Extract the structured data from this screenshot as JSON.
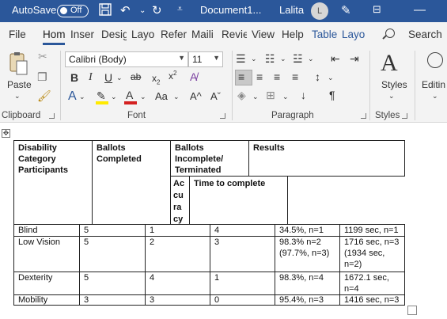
{
  "titlebar": {
    "autosave_label": "AutoSave",
    "autosave_state": "Off",
    "doc_name": "Document1...",
    "user_name": "Lalita",
    "user_initial": "L"
  },
  "tabs": [
    "File",
    "Hom",
    "Inser",
    "Desig",
    "Layo",
    "Refer",
    "Maili",
    "Revie",
    "View",
    "Help",
    "Table",
    "Layo"
  ],
  "search_label": "Search",
  "clipboard": {
    "paste": "Paste",
    "label": "Clipboard"
  },
  "font": {
    "name": "Calibri (Body)",
    "size": "11",
    "label": "Font"
  },
  "paragraph": {
    "label": "Paragraph"
  },
  "styles": {
    "label": "Styles",
    "button": "Styles"
  },
  "editing": {
    "button": "Editin"
  },
  "table": {
    "header": {
      "c1": [
        "Disability",
        "Category",
        "Participants"
      ],
      "c2": [
        "Ballots",
        "Completed"
      ],
      "c3": [
        "Ballots",
        "Incomplete/",
        "Terminated"
      ],
      "c4": "Results",
      "accuracy": [
        "Ac",
        "cu",
        "ra",
        "cy"
      ],
      "time": "Time to complete"
    },
    "rows": [
      {
        "category": "Blind",
        "completed": "5",
        "incomplete": "1",
        "terminated": "4",
        "accuracy": [
          "34.5%, n=1"
        ],
        "time": [
          "1199 sec, n=1"
        ]
      },
      {
        "category": "Low Vision",
        "completed": "5",
        "incomplete": "2",
        "terminated": "3",
        "accuracy": [
          "98.3% n=2",
          "(97.7%, n=3)"
        ],
        "time": [
          "1716 sec, n=3",
          "(1934 sec,",
          "n=2)"
        ]
      },
      {
        "category": "Dexterity",
        "completed": "5",
        "incomplete": "4",
        "terminated": "1",
        "accuracy": [
          "98.3%, n=4"
        ],
        "time": [
          "1672.1 sec,",
          "n=4"
        ]
      },
      {
        "category": "Mobility",
        "completed": "3",
        "incomplete": "3",
        "terminated": "0",
        "accuracy": [
          "95.4%, n=3"
        ],
        "time": [
          "1416 sec, n=3"
        ]
      }
    ]
  }
}
